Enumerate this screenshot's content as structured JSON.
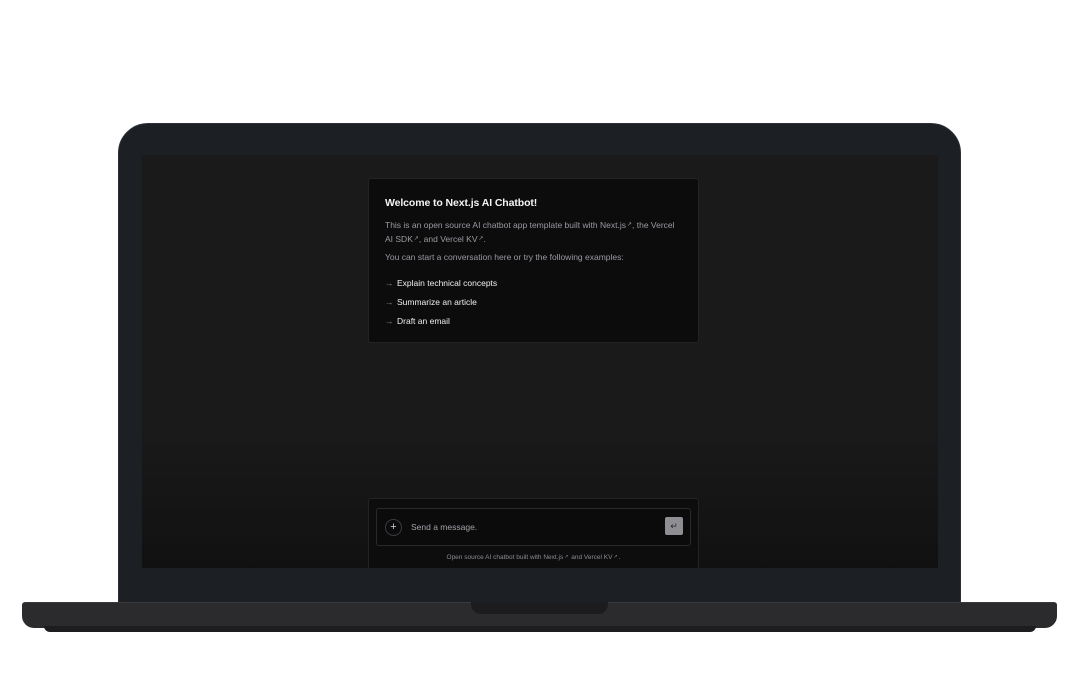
{
  "welcome": {
    "title": "Welcome to Next.js AI Chatbot!",
    "intro_prefix": "This is an open source AI chatbot app template built with ",
    "link_nextjs": "Next.js",
    "intro_mid1": ", the ",
    "link_vercel_ai_sdk": "Vercel AI SDK",
    "intro_mid2": ", and ",
    "link_vercel_kv": "Vercel KV",
    "intro_suffix": ".",
    "external_icon": "↗",
    "prompt": "You can start a conversation here or try the following examples:",
    "examples": [
      {
        "arrow": "→",
        "label": "Explain technical concepts"
      },
      {
        "arrow": "→",
        "label": "Summarize an article"
      },
      {
        "arrow": "→",
        "label": "Draft an email"
      }
    ]
  },
  "composer": {
    "new_chat_icon": "+",
    "placeholder": "Send a message.",
    "send_icon": "↵"
  },
  "footer": {
    "prefix": "Open source AI chatbot built with ",
    "link_nextjs": "Next.js",
    "mid": " and ",
    "link_vercel_kv": "Vercel KV",
    "suffix": ".",
    "external_icon": "↗"
  },
  "colors": {
    "screen_bg": "#1a1a1b",
    "card_bg": "#0c0c0d",
    "send_button": "#8e8e93"
  }
}
